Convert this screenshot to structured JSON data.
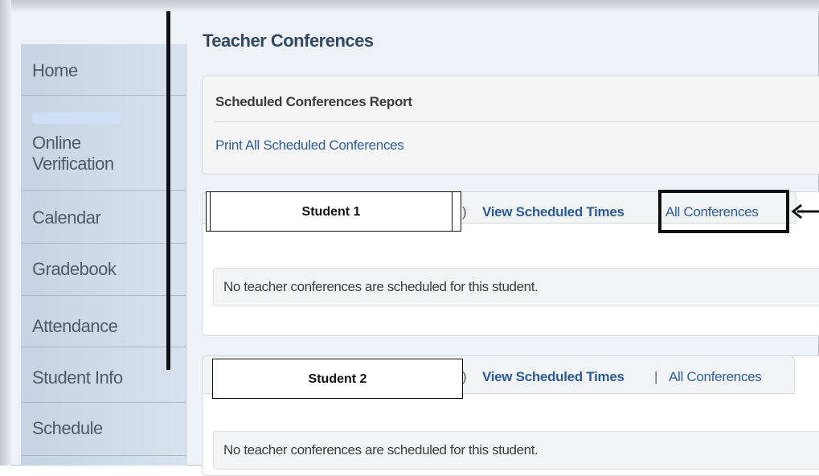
{
  "sidebar": {
    "items": [
      {
        "label": "Home"
      },
      {
        "label": "Online"
      },
      {
        "label": "Verification"
      },
      {
        "label": "Calendar"
      },
      {
        "label": "Gradebook"
      },
      {
        "label": "Attendance"
      },
      {
        "label": "Student Info"
      },
      {
        "label": "Schedule"
      }
    ]
  },
  "main": {
    "title": "Teacher Conferences",
    "report": {
      "title": "Scheduled Conferences Report",
      "print_link": "Print All Scheduled Conferences"
    },
    "students": [
      {
        "name": "Student 1",
        "paren": ")",
        "view_link": "View Scheduled Times",
        "all_link": "All Conferences",
        "message": "No teacher conferences are scheduled for this student."
      },
      {
        "name": "Student 2",
        "paren": ")",
        "view_link": "View Scheduled Times",
        "separator": "|",
        "all_link": "All Conferences",
        "message": "No teacher conferences are scheduled for this student."
      }
    ]
  },
  "colors": {
    "link": "#2f5d9a",
    "sidebar_text": "#4c5a69",
    "title": "#34495e"
  }
}
